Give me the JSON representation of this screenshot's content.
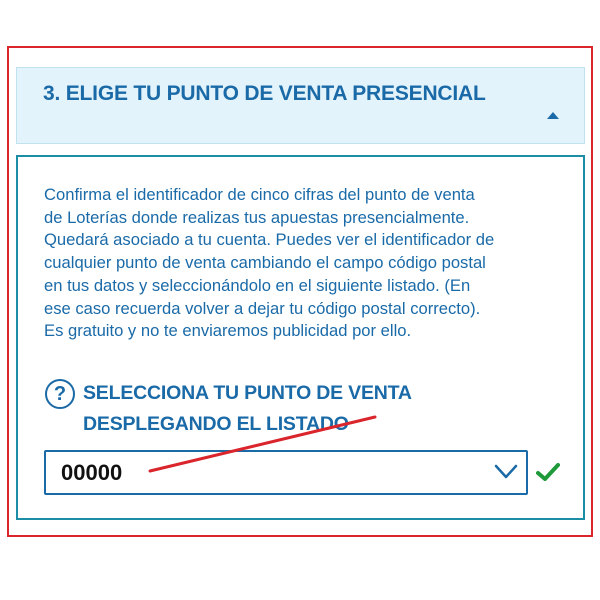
{
  "section": {
    "title": "3. ELIGE TU PUNTO DE VENTA PRESENCIAL",
    "collapse_icon": "caret-up-icon"
  },
  "panel": {
    "description": "Confirma el identificador de cinco cifras del punto de venta\nde Loterías donde realizas tus apuestas presencialmente.\nQuedará asociado a tu cuenta. Puedes ver el identificador de\ncualquier punto de venta cambiando el campo código postal\nen tus datos y seleccionándolo en el siguiente listado. (En\nese caso recuerda volver a dejar tu código postal correcto).\nEs gratuito y no te enviaremos publicidad por ello.",
    "help_icon": "?",
    "select_label_line1": "SELECCIONA TU PUNTO DE VENTA",
    "select_label_line2": "DESPLEGANDO EL LISTADO",
    "select_value": "00000",
    "select_icon": "chevron-down-icon",
    "status_icon": "checkmark-icon"
  },
  "colors": {
    "frame": "#d9252b",
    "brand_blue": "#1a6aa8",
    "panel_border": "#1b8ea6",
    "header_bg": "#e3f3fb",
    "check_green": "#1e9a3a",
    "annotation_red": "#d9252b"
  }
}
